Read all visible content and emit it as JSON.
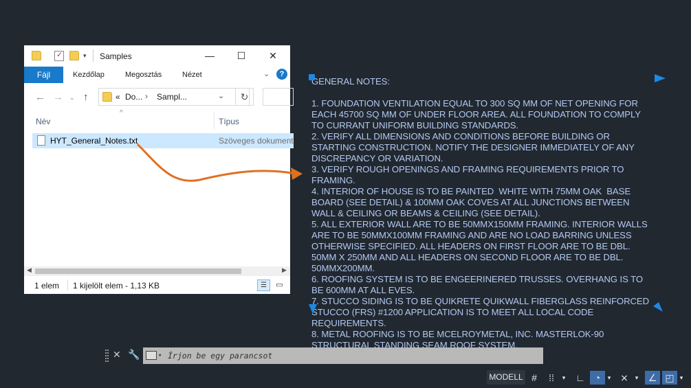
{
  "explorer": {
    "title": "Samples",
    "ribbon": {
      "file": "Fájl",
      "tabs": [
        "Kezdőlap",
        "Megosztás",
        "Nézet"
      ]
    },
    "address": {
      "prefix": "«",
      "crumb1": "Do...",
      "crumb2": "Sampl..."
    },
    "columns": {
      "name": "Név",
      "type": "Típus"
    },
    "file": {
      "name": "HYT_General_Notes.txt",
      "type": "Szöveges dokument"
    },
    "status": {
      "count": "1 elem",
      "selected": "1 kijelölt elem - 1,13 KB"
    }
  },
  "notes": {
    "lines": [
      "GENERAL NOTES:",
      "",
      "1. FOUNDATION VENTILATION EQUAL TO 300 SQ MM OF NET OPENING FOR",
      "EACH 45700 SQ MM OF UNDER FLOOR AREA. ALL FOUNDATION TO COMPLY",
      "TO CURRANT UNIFORM BUILDING STANDARDS.",
      "2. VERIFY ALL DIMENSIONS AND CONDITIONS BEFORE BUILDING OR",
      "STARTING CONSTRUCTION. NOTIFY THE DESIGNER IMMEDIATELY OF ANY",
      "DISCREPANCY OR VARIATION.",
      "3. VERIFY ROUGH OPENINGS AND FRAMING REQUIREMENTS PRIOR TO",
      "FRAMING.",
      "4. INTERIOR OF HOUSE IS TO BE PAINTED  WHITE WITH 75MM OAK  BASE",
      "BOARD (SEE DETAIL) & 100MM OAK COVES AT ALL JUNCTIONS BETWEEN",
      "WALL & CEILING OR BEAMS & CEILING (SEE DETAIL).",
      "5. ALL EXTERIOR WALL ARE TO BE 50MMX150MM FRAMING. INTERIOR WALLS",
      "ARE TO BE 50MMX100MM FRAMING AND ARE NO LOAD BARRING UNLESS",
      "OTHERWISE SPECIFIED. ALL HEADERS ON FIRST FLOOR ARE TO BE DBL.",
      "50MM X 250MM AND ALL HEADERS ON SECOND FLOOR ARE TO BE DBL.",
      "50MMX200MM.",
      "6. ROOFING SYSTEM IS TO BE ENGEERINERED TRUSSES. OVERHANG IS TO",
      "BE 600MM AT ALL EVES.",
      "7. STUCCO SIDING IS TO BE QUIKRETE QUIKWALL FIBERGLASS REINFORCED",
      "STUCCO (FRS) #1200 APPLICATION IS TO MEET ALL LOCAL CODE",
      "REQUIREMENTS.",
      "8. METAL ROOFING IS TO BE MCELROYMETAL, INC. MASTERLOK-90",
      "STRUCTURAL STANDING SEAM ROOF SYSTEM."
    ]
  },
  "command": {
    "placeholder": "Írjon be egy parancsot"
  },
  "statusbar": {
    "model": "MODELL"
  },
  "colors": {
    "accent": "#1979ca",
    "text_notes": "#b3c9f0",
    "canvas": "#212830",
    "arrow": "#e07020"
  }
}
